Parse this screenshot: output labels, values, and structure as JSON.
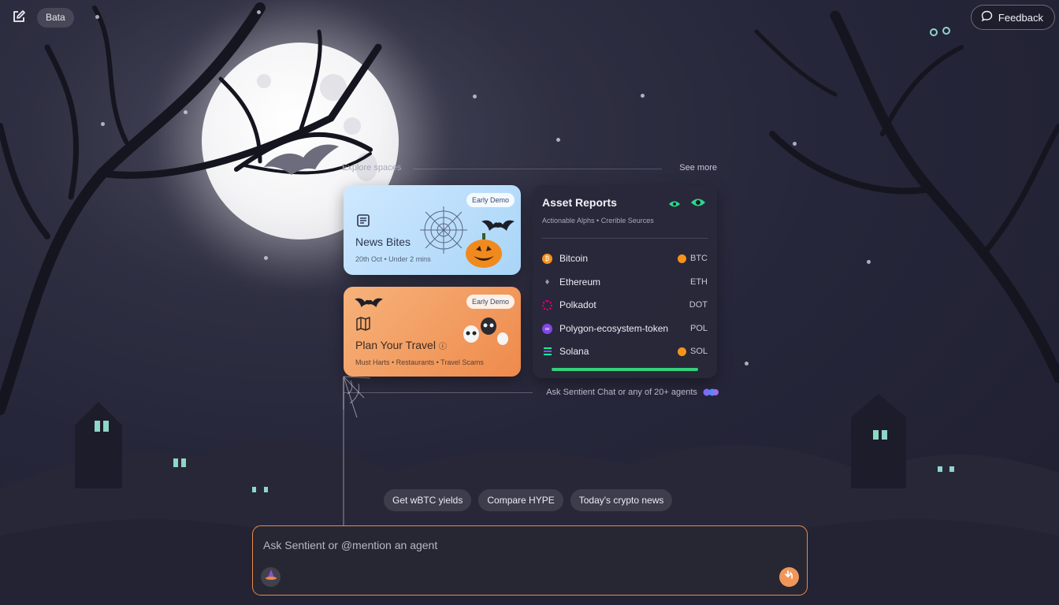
{
  "header": {
    "beta_label": "Bata",
    "feedback_label": "Feedback"
  },
  "explore": {
    "label": "Explore spaces",
    "see_more": "See more"
  },
  "cards": {
    "news": {
      "badge": "Early Demo",
      "title": "News Bites",
      "meta": "20th Oct • Under 2 mins"
    },
    "travel": {
      "badge": "Early Demo",
      "title": "Plan Your Travel",
      "meta": "Must Harts • Restaurants • Travel Scams"
    }
  },
  "assets": {
    "title": "Asset Reports",
    "subtitle": "Actionable Alphs • Crerible Seurces",
    "items": [
      {
        "name": "Bitcoin",
        "ticker": "BTC",
        "color": "#f7931a"
      },
      {
        "name": "Ethereum",
        "ticker": "ETH",
        "color": "#8c8fb0"
      },
      {
        "name": "Polkadot",
        "ticker": "DOT",
        "color": "#e6007a"
      },
      {
        "name": "Polygon-ecosystem-token",
        "ticker": "POL",
        "color": "#8247e5"
      },
      {
        "name": "Solana",
        "ticker": "SOL",
        "color": "#14f195"
      }
    ],
    "progress_color": "#34d07a"
  },
  "hint": {
    "text": "Ask Sentient Chat or any of 20+ agents"
  },
  "suggestions": [
    "Get wBTC yields",
    "Compare HYPE",
    "Today's crypto news"
  ],
  "composer": {
    "placeholder": "Ask Sentient or @mention an agent"
  },
  "theme": {
    "accent": "#e88a4a",
    "send_button": "#f0965a"
  }
}
